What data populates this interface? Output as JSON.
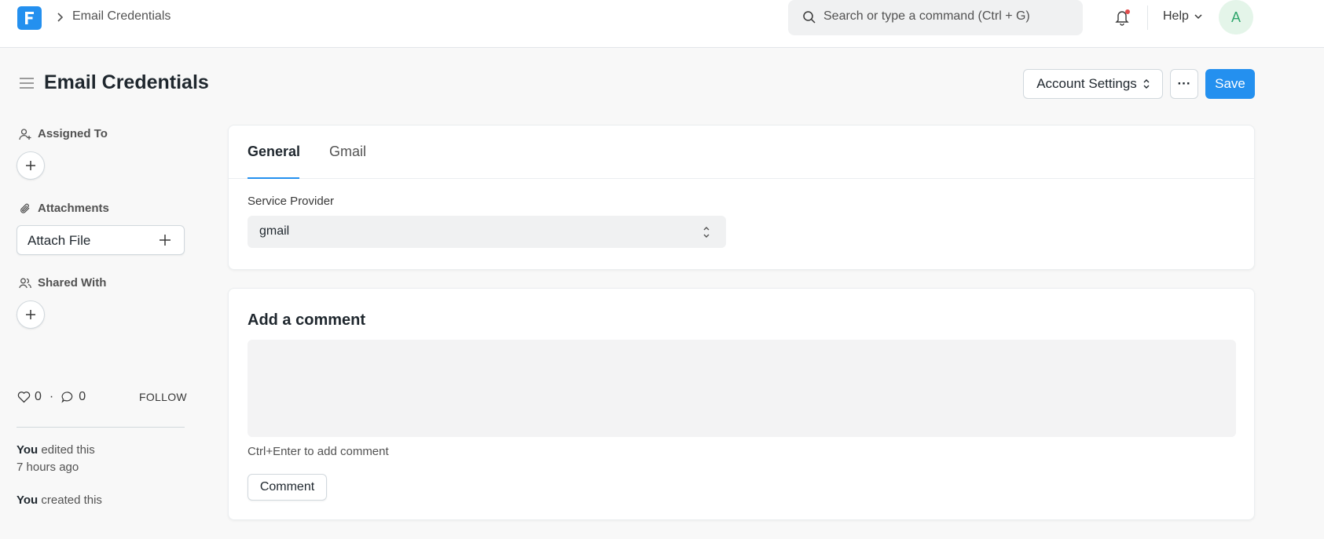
{
  "navbar": {
    "app_logo_icon": "frappe-logo-icon",
    "breadcrumb": "Email Credentials",
    "search_placeholder": "Search or type a command (Ctrl + G)",
    "help_label": "Help",
    "avatar_initial": "A",
    "notification_dot_color": "#e24c4c"
  },
  "page": {
    "title": "Email Credentials",
    "account_settings_label": "Account Settings",
    "more_label": "···",
    "save_label": "Save"
  },
  "sidebar": {
    "assigned_to_label": "Assigned To",
    "attachments_label": "Attachments",
    "attach_file_label": "Attach File",
    "shared_with_label": "Shared With",
    "likes_count": "0",
    "separator": "·",
    "comments_count": "0",
    "follow_label": "FOLLOW",
    "activity": [
      {
        "user": "You",
        "action": "edited this",
        "time": "7 hours ago"
      },
      {
        "user": "You",
        "action": "created this"
      }
    ]
  },
  "form": {
    "tabs": [
      {
        "label": "General",
        "active": true
      },
      {
        "label": "Gmail",
        "active": false
      }
    ],
    "service_provider_label": "Service Provider",
    "service_provider_value": "gmail"
  },
  "comment": {
    "title": "Add a comment",
    "hint": "Ctrl+Enter to add comment",
    "button_label": "Comment"
  },
  "colors": {
    "primary": "#2490ef",
    "background": "#f8f8f8",
    "avatar_bg": "#e4f5e9",
    "avatar_text": "#30a66d"
  }
}
